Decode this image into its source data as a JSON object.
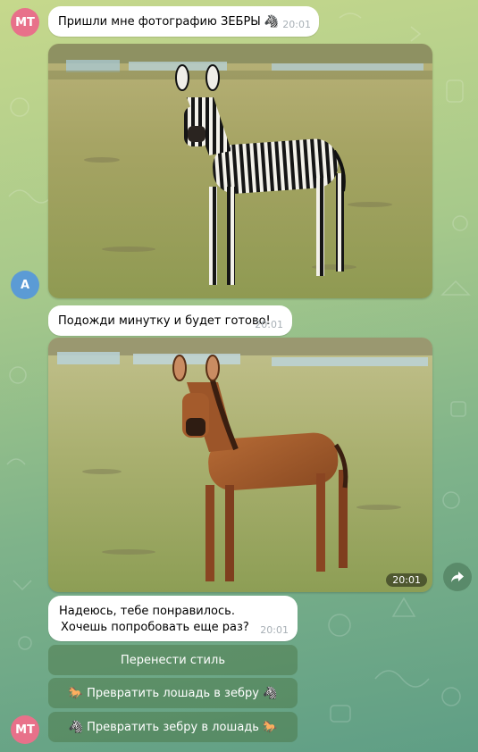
{
  "chat": {
    "user_avatar_initials": "MT",
    "bot_avatar_initial": "A",
    "messages": {
      "request_text": "Пришли мне фотографию ЗЕБРЫ 🦓",
      "request_time": "20:01",
      "wait_text": "Подожди минутку и будет готово!",
      "wait_time": "20:01",
      "result_photo_time": "20:01",
      "hope_line1": "Надеюсь, тебе понравилось.",
      "hope_line2": "Хочешь попробовать еще раз?",
      "hope_time": "20:01"
    },
    "keyboard": {
      "style_transfer": "Перенести стиль",
      "horse_to_zebra": "Превратить лошадь в зебру",
      "horse_to_zebra_emoji_left": "🐎",
      "horse_to_zebra_emoji_right": "🦓",
      "zebra_to_horse": "Превратить зебру в лошадь",
      "zebra_to_horse_emoji_left": "🦓",
      "zebra_to_horse_emoji_right": "🐎"
    }
  },
  "colors": {
    "user_avatar": "#e8718a",
    "bot_avatar": "#5b9bd5",
    "bubble": "#ffffff"
  },
  "icons": [
    "forward-arrow-icon"
  ]
}
